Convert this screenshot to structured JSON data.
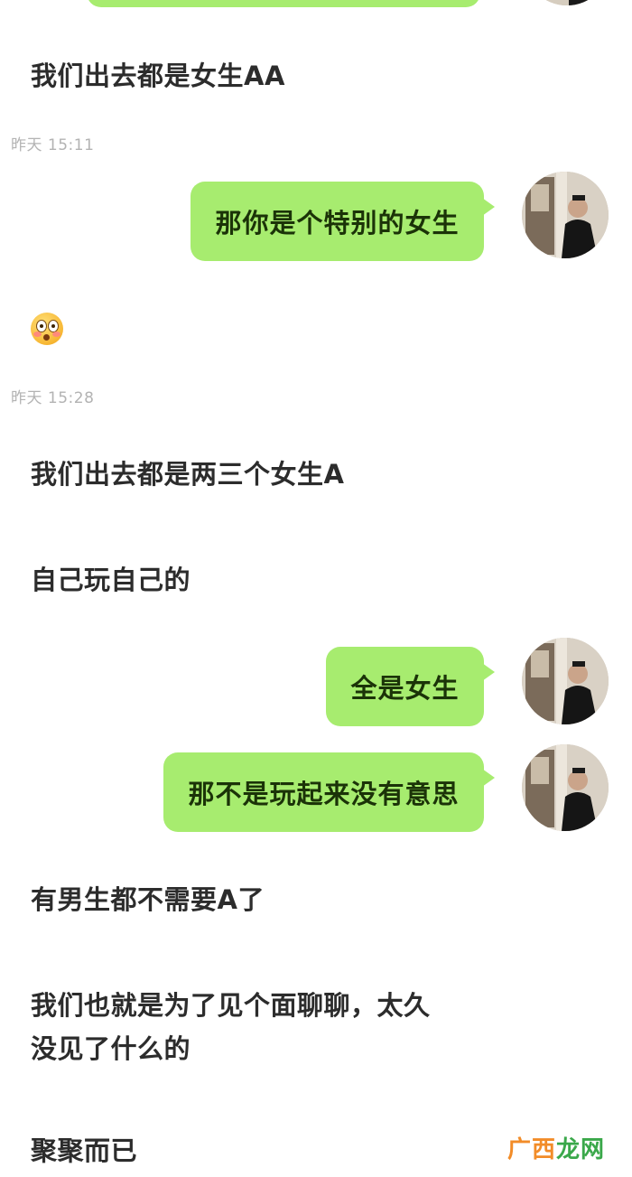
{
  "messages": {
    "m1": "我们出去都是女生AA",
    "t1": "昨天 15:11",
    "b1": "那你是个特别的女生",
    "m2": "😳",
    "t2": "昨天 15:28",
    "m3": "我们出去都是两三个女生A",
    "m4": "自己玩自己的",
    "b2": "全是女生",
    "b3": "那不是玩起来没有意思",
    "m5": "有男生都不需要A了",
    "m6_line1": "我们也就是为了见个面聊聊，太久",
    "m6_line2": "没见了什么的",
    "m7": "聚聚而已"
  },
  "icons": {
    "avatar": "user-avatar-photo",
    "emoji": "flushed-face-emoji"
  },
  "colors": {
    "bubble": "#a7ec6f",
    "text": "#2c2c2c",
    "timestamp": "#b3b3b3",
    "watermark_orange": "#f28c28",
    "watermark_green": "#3aa84a"
  },
  "watermark": {
    "part1": "广西",
    "part2": "龙网"
  }
}
